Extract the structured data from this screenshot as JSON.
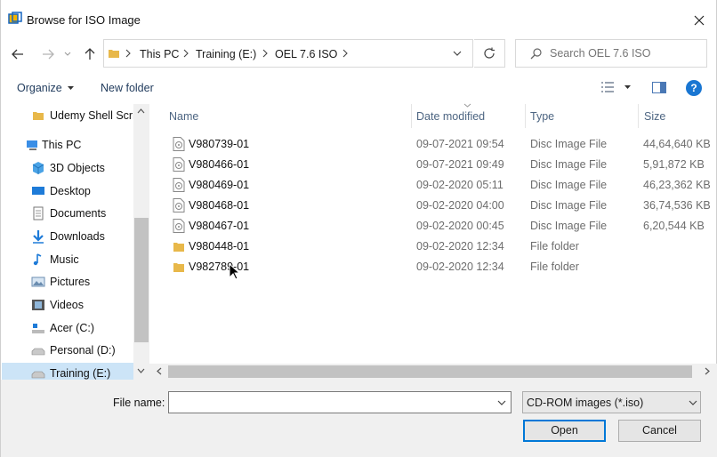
{
  "window": {
    "title": "Browse for ISO Image"
  },
  "address": {
    "breadcrumbs": [
      "This PC",
      "Training (E:)",
      "OEL 7.6 ISO"
    ]
  },
  "search": {
    "placeholder": "Search OEL 7.6 ISO"
  },
  "toolbar": {
    "organize_label": "Organize",
    "new_folder_label": "New folder"
  },
  "nav": {
    "items": [
      {
        "label": "Udemy Shell Scri",
        "icon": "folder-icon"
      },
      {
        "label": "This PC",
        "icon": "pc-icon"
      },
      {
        "label": "3D Objects",
        "icon": "3d-objects-icon"
      },
      {
        "label": "Desktop",
        "icon": "desktop-icon"
      },
      {
        "label": "Documents",
        "icon": "documents-icon"
      },
      {
        "label": "Downloads",
        "icon": "downloads-icon"
      },
      {
        "label": "Music",
        "icon": "music-icon"
      },
      {
        "label": "Pictures",
        "icon": "pictures-icon"
      },
      {
        "label": "Videos",
        "icon": "videos-icon"
      },
      {
        "label": "Acer (C:)",
        "icon": "drive-icon"
      },
      {
        "label": "Personal (D:)",
        "icon": "drive-icon"
      },
      {
        "label": "Training (E:)",
        "icon": "drive-icon"
      }
    ]
  },
  "columns": {
    "name": "Name",
    "date": "Date modified",
    "type": "Type",
    "size": "Size"
  },
  "files": [
    {
      "name": "V980739-01",
      "date": "09-07-2021 09:54",
      "type": "Disc Image File",
      "size": "44,64,640 KB",
      "kind": "disc"
    },
    {
      "name": "V980466-01",
      "date": "09-07-2021 09:49",
      "type": "Disc Image File",
      "size": "5,91,872 KB",
      "kind": "disc"
    },
    {
      "name": "V980469-01",
      "date": "09-02-2020 05:11",
      "type": "Disc Image File",
      "size": "46,23,362 KB",
      "kind": "disc"
    },
    {
      "name": "V980468-01",
      "date": "09-02-2020 04:00",
      "type": "Disc Image File",
      "size": "36,74,536 KB",
      "kind": "disc"
    },
    {
      "name": "V980467-01",
      "date": "09-02-2020 00:45",
      "type": "Disc Image File",
      "size": "6,20,544 KB",
      "kind": "disc"
    },
    {
      "name": "V980448-01",
      "date": "09-02-2020 12:34",
      "type": "File folder",
      "size": "",
      "kind": "folder"
    },
    {
      "name": "V982789-01",
      "date": "09-02-2020 12:34",
      "type": "File folder",
      "size": "",
      "kind": "folder"
    }
  ],
  "bottom": {
    "filename_label": "File name:",
    "filename_value": "",
    "filetype_selected": "CD-ROM images (*.iso)",
    "open_label": "Open",
    "cancel_label": "Cancel"
  },
  "colors": {
    "accent": "#0078d7",
    "folder": "#e8b84a",
    "help": "#1976d2"
  }
}
